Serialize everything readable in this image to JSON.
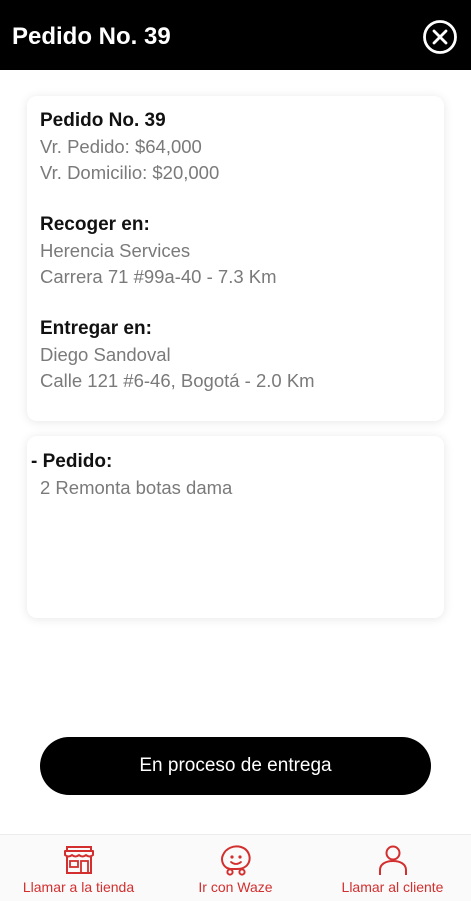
{
  "header": {
    "title": "Pedido No. 39"
  },
  "order_card": {
    "order_title": "Pedido No. 39",
    "order_value": "Vr. Pedido: $64,000",
    "delivery_fee": "Vr. Domicilio: $20,000",
    "pickup_title": "Recoger en:",
    "pickup_name": "Herencia Services",
    "pickup_address": "Carrera 71 #99a-40 - 7.3 Km",
    "delivery_title": "Entregar en:",
    "delivery_name": "Diego Sandoval",
    "delivery_address": "Calle 121 #6-46, Bogotá - 2.0 Km"
  },
  "items_card": {
    "title": "- Pedido:",
    "items": "2 Remonta botas dama"
  },
  "action_button": {
    "label": "En proceso de entrega"
  },
  "bottom_nav": [
    {
      "label": "Llamar a la tienda",
      "icon": "store-icon"
    },
    {
      "label": "Ir con Waze",
      "icon": "waze-icon"
    },
    {
      "label": "Llamar al cliente",
      "icon": "user-icon"
    }
  ],
  "colors": {
    "header_bg": "#000000",
    "accent": "#d32f2f",
    "muted_text": "#7a7a7a"
  }
}
